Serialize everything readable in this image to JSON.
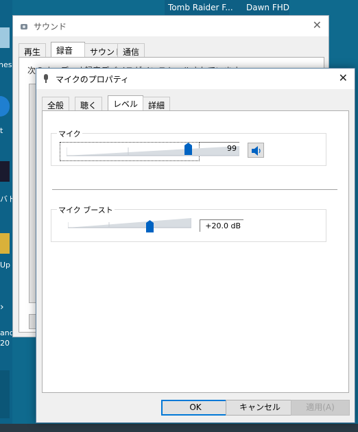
{
  "taskbar": {
    "item1": "Tomb Raider F...",
    "item2": "Dawn FHD"
  },
  "desktop": {
    "label_nes": "nes",
    "label_t": "t",
    "label_battery": "バトル",
    "label_up": "Up",
    "label_and": "and",
    "label_20": "20"
  },
  "sound_window": {
    "title": "サウンド",
    "tabs": [
      "再生",
      "録音",
      "サウンド",
      "通信"
    ],
    "selected_tab": 1,
    "instruction": "次のオーディオ録音デバイスがインストールされています"
  },
  "mic_dialog": {
    "title": "マイクのプロパティ",
    "tabs": [
      "全般",
      "聴く",
      "レベル",
      "詳細"
    ],
    "selected_tab": 2,
    "mic_group_label": "マイク",
    "mic_level": 99,
    "mic_value_text": "99",
    "boost_group_label": "マイク ブースト",
    "boost_level_fraction": 0.667,
    "boost_value_text": "+20.0 dB",
    "buttons": {
      "ok": "OK",
      "cancel": "キャンセル",
      "apply": "適用(A)"
    }
  },
  "colors": {
    "accent": "#0078d7",
    "desktop": "#0f6a8e",
    "thumb": "#0063c2"
  }
}
